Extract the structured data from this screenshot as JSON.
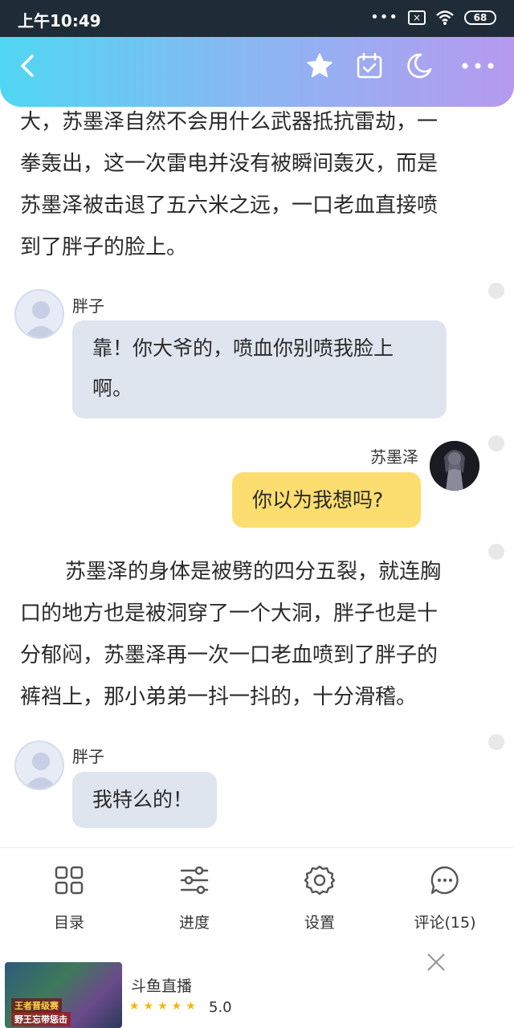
{
  "status_bar": {
    "time": "上午10:49",
    "dots": "•••",
    "battery": "68"
  },
  "header": {
    "icons": [
      "back-chevron-icon",
      "star-icon",
      "calendar-check-icon",
      "moon-icon",
      "more-dots-icon"
    ],
    "gradient": [
      "#4fd6f2",
      "#b69af0"
    ]
  },
  "content": {
    "para1": [
      "大，苏墨泽自然不会用什么武器抵抗雷劫，一",
      "拳轰出，这一次雷电并没有被瞬间轰灭，而是",
      "苏墨泽被击退了五六米之远，一口老血直接喷",
      "到了胖子的脸上。"
    ],
    "msg1": {
      "speaker": "胖子",
      "lines": [
        "靠！你大爷的，喷血你别喷我脸上",
        "啊。"
      ]
    },
    "msg2": {
      "speaker": "苏墨泽",
      "text": "你以为我想吗?"
    },
    "para2": [
      "苏墨泽的身体是被劈的四分五裂，就连胸",
      "口的地方也是被洞穿了一个大洞，胖子也是十",
      "分郁闷，苏墨泽再一次一口老血喷到了胖子的",
      "裤裆上，那小弟弟一抖一抖的，十分滑稽。"
    ],
    "msg3": {
      "speaker": "胖子",
      "text": "我特么的！"
    }
  },
  "toolbar": {
    "catalog": "目录",
    "progress": "进度",
    "settings": "设置",
    "comments": "评论(15)"
  },
  "ad": {
    "thumb_title": "王者晋级赛",
    "thumb_sub": "野王忘带惩击",
    "title": "斗鱼直播",
    "stars": "★★★★★",
    "rating": "5.0"
  },
  "colors": {
    "bubble_left": "#dfe5ef",
    "bubble_right": "#fcdd6f"
  }
}
